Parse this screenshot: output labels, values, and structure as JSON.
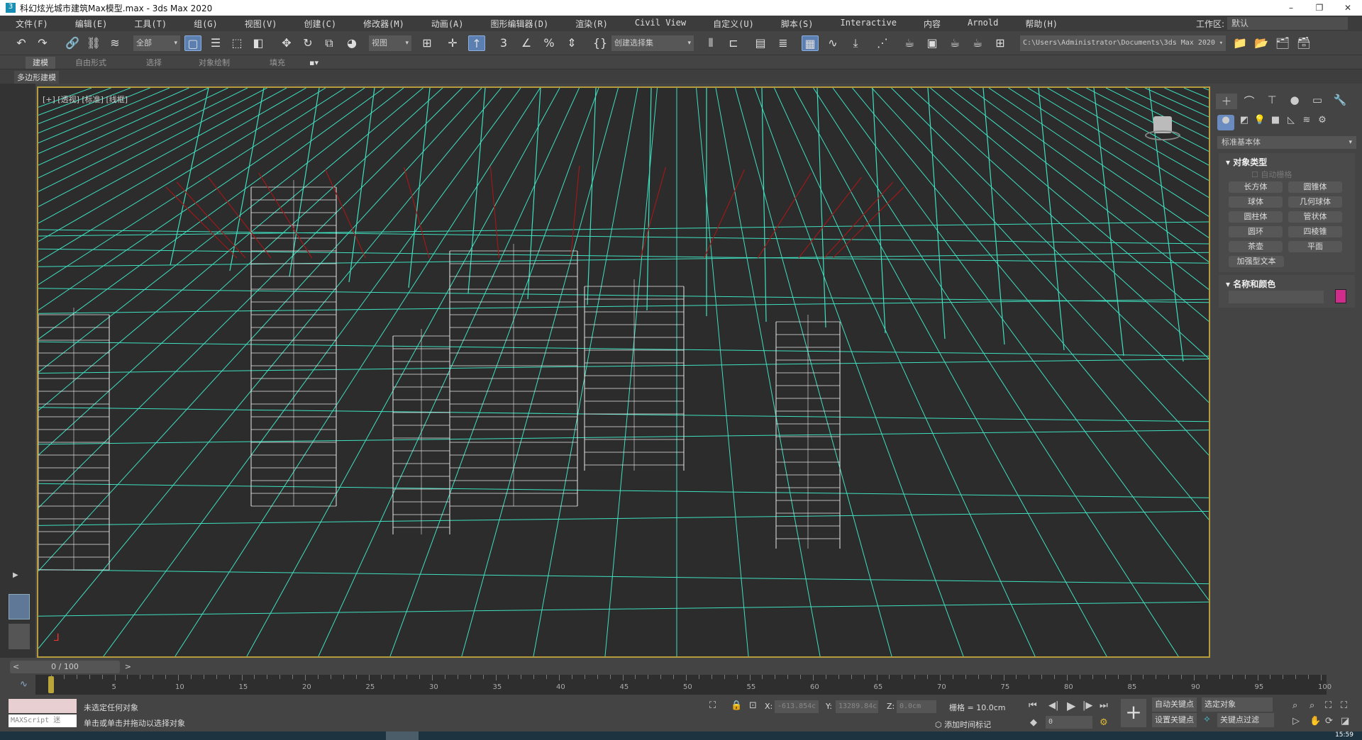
{
  "window": {
    "title": "科幻炫光城市建筑Max模型.max - 3ds Max 2020",
    "app_icon": "3",
    "minimize": "–",
    "restore": "❐",
    "close": "✕"
  },
  "menu": [
    "文件(F)",
    "编辑(E)",
    "工具(T)",
    "组(G)",
    "视图(V)",
    "创建(C)",
    "修改器(M)",
    "动画(A)",
    "图形编辑器(D)",
    "渲染(R)",
    "Civil View",
    "自定义(U)",
    "脚本(S)",
    "Interactive",
    "内容",
    "Arnold",
    "帮助(H)"
  ],
  "workspace": {
    "label": "工作区:",
    "value": "默认"
  },
  "toolbar": {
    "selection_filter": "全部",
    "ref_coord": "视图",
    "named_selection": "创建选择集",
    "project_path": "C:\\Users\\Administrator\\Documents\\3ds Max 2020"
  },
  "ribbon": {
    "tabs": [
      "建模",
      "自由形式",
      "选择",
      "对象绘制",
      "填充"
    ],
    "active_panel": "多边形建模"
  },
  "viewport": {
    "label": "[+] [透视] [标准] [线框]",
    "grid_color": "#3fe0c0",
    "wire_color": "#e8e8e8",
    "accent_red": "#a01818"
  },
  "command_panel": {
    "category": "标准基本体",
    "rollout_object_type": "对象类型",
    "autogrid": "自动栅格",
    "buttons": [
      "长方体",
      "圆锥体",
      "球体",
      "几何球体",
      "圆柱体",
      "管状体",
      "圆环",
      "四棱锥",
      "茶壶",
      "平面",
      "加强型文本"
    ],
    "rollout_name_color": "名称和颜色",
    "object_color": "#d02c8c"
  },
  "timeline": {
    "frame": "0 / 100",
    "ticks": [
      "0",
      "5",
      "10",
      "15",
      "20",
      "25",
      "30",
      "35",
      "40",
      "45",
      "50",
      "55",
      "60",
      "65",
      "70",
      "75",
      "80",
      "85",
      "90",
      "95",
      "100"
    ],
    "prev": "<",
    "next": ">"
  },
  "status": {
    "maxscript": "MAXScript 迷",
    "line1": "未选定任何对象",
    "line2": "单击或单击并拖动以选择对象",
    "x_label": "X:",
    "x": "-613.854c",
    "y_label": "Y:",
    "y": "13289.84c",
    "z_label": "Z:",
    "z": "0.0cm",
    "grid": "栅格 = 10.0cm",
    "add_time_tag": "添加时间标记",
    "current_frame": "0",
    "auto_key": "自动关键点",
    "set_key": "设置关键点",
    "key_mode": "选定对象",
    "key_filters": "关键点过滤器..."
  },
  "taskbar": {
    "clock": "15:59"
  }
}
